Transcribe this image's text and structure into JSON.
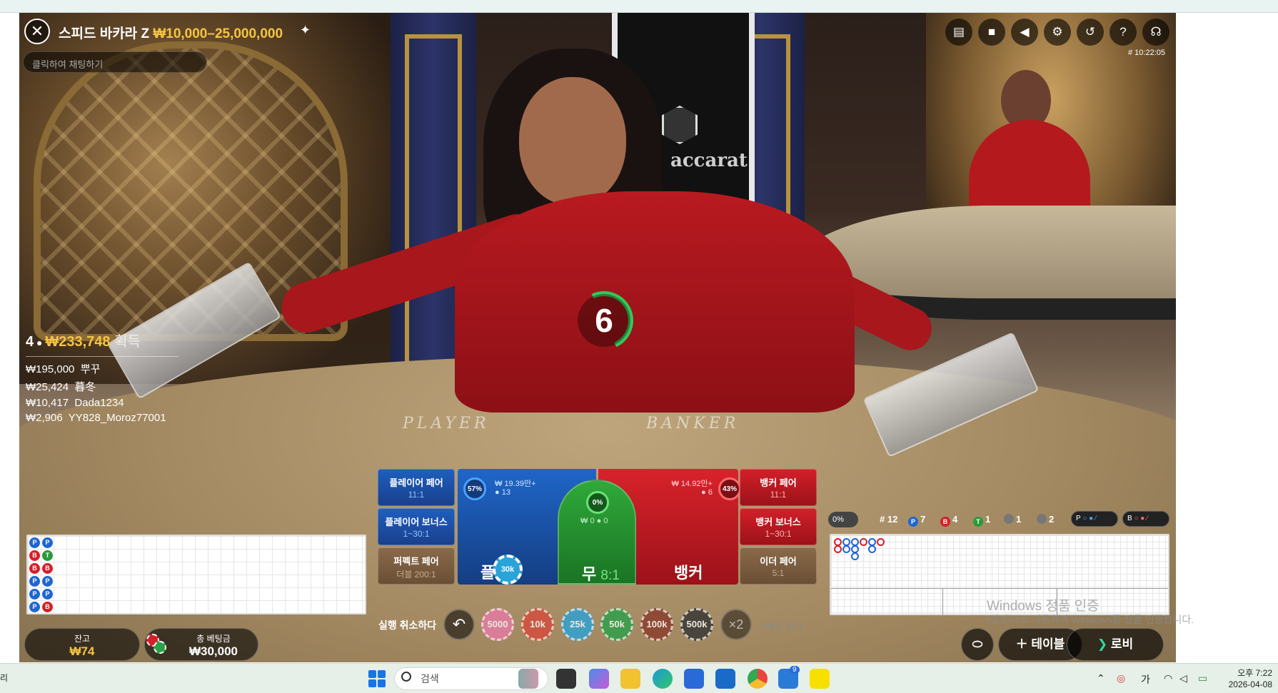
{
  "game": {
    "title": "스피드 바카라 Z",
    "limits": "₩10,000–25,000,000",
    "chat_placeholder": "클릭하여 채팅하기",
    "round_id": "# 10:22:05",
    "countdown": "6"
  },
  "winners": {
    "count": "4",
    "total": "₩233,748",
    "suffix": "획득",
    "list": [
      {
        "amount": "₩195,000",
        "name": "뿌꾸"
      },
      {
        "amount": "₩25,424",
        "name": "暮冬"
      },
      {
        "amount": "₩10,417",
        "name": "Dada1234"
      },
      {
        "amount": "₩2,906",
        "name": "YY828_Moroz77001"
      }
    ]
  },
  "bets": {
    "player_pair": {
      "label": "플레이어 페어",
      "odds": "11:1"
    },
    "player_bonus": {
      "label": "플레이어 보너스",
      "odds": "1~30:1"
    },
    "perfect_pair": {
      "label": "퍼펙트 페어",
      "odds": "더블 200:1"
    },
    "banker_pair": {
      "label": "뱅커 페어",
      "odds": "11:1"
    },
    "banker_bonus": {
      "label": "뱅커 보너스",
      "odds": "1~30:1"
    },
    "either_pair": {
      "label": "이더 페어",
      "odds": "5:1"
    },
    "player": {
      "label": "플레이어",
      "label_visible": "플  어",
      "pct": "57%",
      "amount": "₩ 19.39만+",
      "players": "13"
    },
    "tie": {
      "label": "무",
      "odds": "8:1",
      "pct": "0%",
      "amount": "₩ 0",
      "players": "0"
    },
    "banker": {
      "label": "뱅커",
      "pct": "43%",
      "amount": "₩ 14.92만+",
      "players": "6"
    },
    "placed_chip": "30k"
  },
  "chips": {
    "undo_label": "실행 취소하다",
    "values": [
      "5000",
      "10k",
      "25k",
      "50k",
      "100k",
      "500k"
    ],
    "double_btn": "×2",
    "double_label": "2배로 하다"
  },
  "balance": {
    "label": "잔고",
    "value": "₩74",
    "bet_label": "총 베팅금",
    "bet_value": "₩30,000"
  },
  "stats": {
    "pct": "0%",
    "rounds": "# 12",
    "player": "7",
    "banker": "4",
    "tie": "1",
    "player_pair": "1",
    "banker_pair": "2",
    "p_pred": "P",
    "b_pred": "B"
  },
  "bead_road": [
    [
      "P",
      "P"
    ],
    [
      "B",
      "T"
    ],
    [
      "B",
      "B"
    ],
    [
      "P",
      "P"
    ],
    [
      "P",
      "P"
    ],
    [
      "P",
      "B"
    ]
  ],
  "watermark": {
    "line1": "Windows 정품 인증",
    "line2": "[설정]으로 이동하여 Windows를 정품 인증합니다."
  },
  "buttons": {
    "tables": "테이블",
    "lobby": "로비"
  },
  "taskbar": {
    "left_text": "리",
    "search": "검색",
    "ime": "가",
    "time": "오후 7:22",
    "date": "2026-04-08",
    "badge": "9"
  },
  "colors": {
    "player": "#1f66c8",
    "banker": "#d3202a",
    "tie": "#2fa93a",
    "gold": "#f5c542"
  }
}
